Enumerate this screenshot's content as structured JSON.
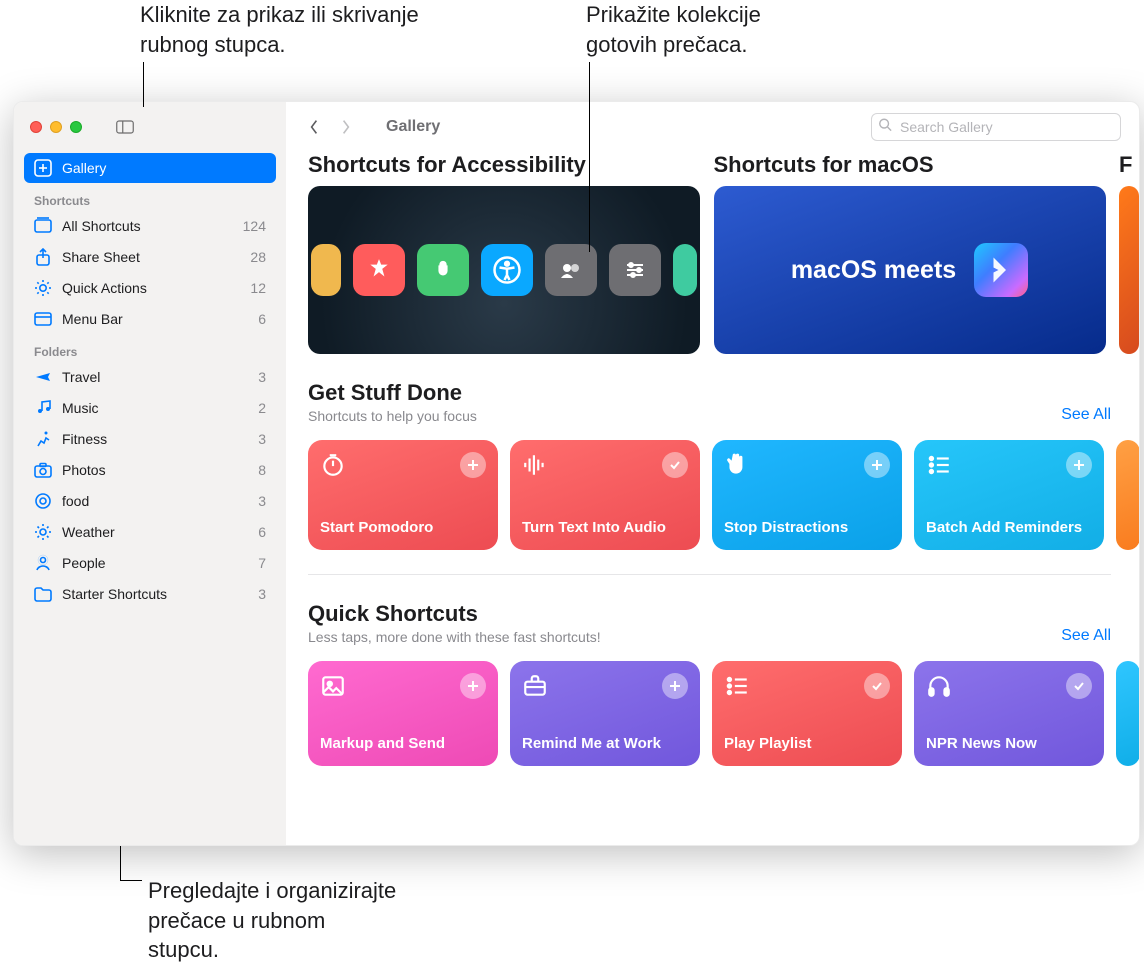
{
  "callouts": {
    "sidebar_toggle": "Kliknite za prikaz ili skrivanje rubnog stupca.",
    "collections": "Prikažite kolekcije gotovih prečaca.",
    "sidebar_browse": "Pregledajte i organizirajte prečace u rubnom stupcu."
  },
  "toolbar": {
    "title": "Gallery",
    "search_placeholder": "Search Gallery"
  },
  "sidebar": {
    "gallery_label": "Gallery",
    "shortcuts_header": "Shortcuts",
    "folders_header": "Folders",
    "items": [
      {
        "label": "All Shortcuts",
        "count": "124"
      },
      {
        "label": "Share Sheet",
        "count": "28"
      },
      {
        "label": "Quick Actions",
        "count": "12"
      },
      {
        "label": "Menu Bar",
        "count": "6"
      }
    ],
    "folders": [
      {
        "label": "Travel",
        "count": "3"
      },
      {
        "label": "Music",
        "count": "2"
      },
      {
        "label": "Fitness",
        "count": "3"
      },
      {
        "label": "Photos",
        "count": "8"
      },
      {
        "label": "food",
        "count": "3"
      },
      {
        "label": "Weather",
        "count": "6"
      },
      {
        "label": "People",
        "count": "7"
      },
      {
        "label": "Starter Shortcuts",
        "count": "3"
      }
    ]
  },
  "sections": {
    "banners": [
      {
        "title": "Shortcuts for Accessibility"
      },
      {
        "title": "Shortcuts for macOS",
        "slogan": "macOS meets"
      }
    ],
    "get_stuff_done": {
      "title": "Get Stuff Done",
      "subtitle": "Shortcuts to help you focus",
      "see_all": "See All",
      "cards": [
        {
          "name": "Start Pomodoro",
          "icon": "timer-icon",
          "color": "red",
          "badge": "plus"
        },
        {
          "name": "Turn Text Into Audio",
          "icon": "waveform-icon",
          "color": "red",
          "badge": "check"
        },
        {
          "name": "Stop Distractions",
          "icon": "hand-icon",
          "color": "blue",
          "badge": "plus"
        },
        {
          "name": "Batch Add Reminders",
          "icon": "list-icon",
          "color": "cyan",
          "badge": "plus"
        }
      ]
    },
    "quick_shortcuts": {
      "title": "Quick Shortcuts",
      "subtitle": "Less taps, more done with these fast shortcuts!",
      "see_all": "See All",
      "cards": [
        {
          "name": "Markup and Send",
          "icon": "image-icon",
          "color": "pink",
          "badge": "plus"
        },
        {
          "name": "Remind Me at Work",
          "icon": "briefcase-icon",
          "color": "purple",
          "badge": "plus"
        },
        {
          "name": "Play Playlist",
          "icon": "list-icon",
          "color": "red",
          "badge": "check"
        },
        {
          "name": "NPR News Now",
          "icon": "headphones-icon",
          "color": "purple",
          "badge": "check"
        }
      ]
    }
  }
}
